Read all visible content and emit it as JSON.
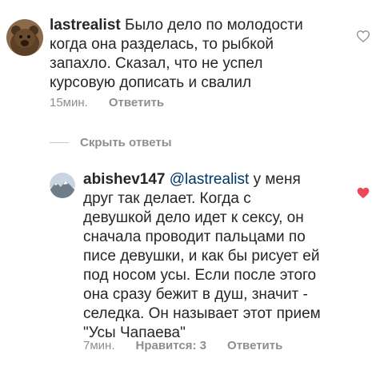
{
  "comment1": {
    "username": "lastrealist",
    "text_line1": " Было дело по молодости",
    "text_lines": [
      "когда она разделась, то рыбкой",
      "запахло. Сказал, что не успел",
      "курсовую дописать и свалил"
    ],
    "time": "15мин.",
    "reply_label": "Ответить"
  },
  "replies_toggle": {
    "label": "Скрыть ответы"
  },
  "comment2": {
    "username": "abishev147",
    "mention": "@lastrealist",
    "text_line1": " у меня",
    "text_lines": [
      "друг так делает. Когда с",
      "девушкой дело идет к сексу, он",
      "сначала проводит пальцами по",
      "писе девушки, и как бы рисует ей",
      "под носом усы. Если после этого",
      "она сразу бежит в душ, значит -",
      "селедка. Он называет этот прием",
      "\"Усы Чапаева\""
    ],
    "time": "7мин.",
    "likes_label": "Нравится: 3",
    "reply_label": "Ответить",
    "liked": true
  },
  "colors": {
    "heart_liked": "#ed4956",
    "heart_empty": "#8e8e8e",
    "meta": "#8e8e8e",
    "text": "#262626"
  }
}
